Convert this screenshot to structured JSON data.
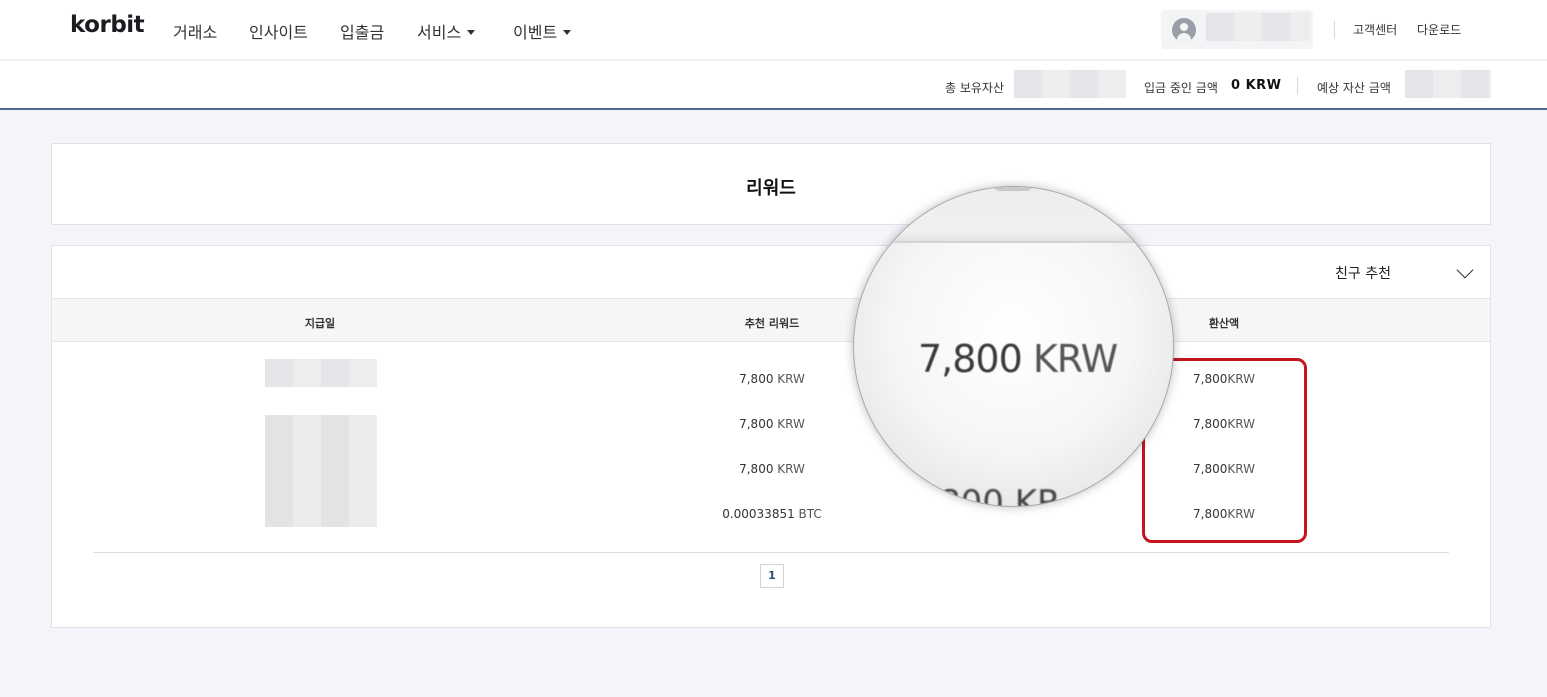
{
  "brand": {
    "logo": "korbit"
  },
  "nav": {
    "items": [
      {
        "label": "거래소"
      },
      {
        "label": "인사이트"
      },
      {
        "label": "입출금"
      },
      {
        "label": "서비스"
      },
      {
        "label": "이벤트"
      }
    ]
  },
  "header_links": {
    "support": "고객센터",
    "download": "다운로드"
  },
  "balance_bar": {
    "total_assets_label": "총 보유자산",
    "pending_deposit_label": "입금 중인 금액",
    "pending_deposit_value": "0 KRW",
    "estimated_assets_label": "예상 자산 금액"
  },
  "page": {
    "title": "리워드"
  },
  "filter": {
    "selected": "친구 추천"
  },
  "table": {
    "headers": {
      "date": "지급일",
      "reward": "추천 리워드",
      "converted": "환산액"
    },
    "rows": [
      {
        "reward_amount": "7,800",
        "reward_unit": "KRW",
        "converted_amount": "7,800",
        "converted_unit": "KRW"
      },
      {
        "reward_amount": "7,800",
        "reward_unit": "KRW",
        "converted_amount": "7,800",
        "converted_unit": "KRW"
      },
      {
        "reward_amount": "7,800",
        "reward_unit": "KRW",
        "converted_amount": "7,800",
        "converted_unit": "KRW"
      },
      {
        "reward_amount": "0.00033851",
        "reward_unit": "BTC",
        "converted_amount": "7,800",
        "converted_unit": "KRW"
      }
    ]
  },
  "pagination": {
    "current": "1"
  },
  "magnifier": {
    "amount": "7,800",
    "unit": "KRW",
    "bottom_fragment": "800 KR"
  },
  "colors": {
    "highlight": "#c3161c",
    "divider": "#4a6b93",
    "page_bg": "#f4f5fa"
  }
}
